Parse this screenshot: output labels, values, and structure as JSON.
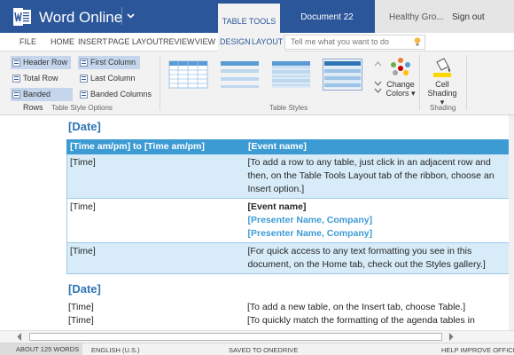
{
  "titlebar": {
    "app_name": "Word Online",
    "context_tab": "TABLE TOOLS",
    "document_title": "Document 22",
    "user_name": "Healthy Gro...",
    "sign_out": "Sign out"
  },
  "ribbon_tabs": [
    {
      "label": "FILE"
    },
    {
      "label": "HOME"
    },
    {
      "label": "INSERT"
    },
    {
      "label": "PAGE LAYOUT"
    },
    {
      "label": "REVIEW"
    },
    {
      "label": "VIEW"
    },
    {
      "label": "DESIGN",
      "contextual": true
    },
    {
      "label": "LAYOUT",
      "contextual": true
    }
  ],
  "tell_me": {
    "placeholder": "Tell me what you want to do",
    "icon": "lightbulb-icon"
  },
  "table_style_options": {
    "group_label": "Table Style Options",
    "checkboxes": [
      {
        "label": "Header Row",
        "checked": true
      },
      {
        "label": "First Column",
        "checked": true
      },
      {
        "label": "Total Row",
        "checked": false
      },
      {
        "label": "Last Column",
        "checked": false
      },
      {
        "label": "Banded Rows",
        "checked": true
      },
      {
        "label": "Banded Columns",
        "checked": false
      }
    ]
  },
  "table_styles": {
    "group_label": "Table Styles",
    "change_colors_line1": "Change",
    "change_colors_line2": "Colors ▾"
  },
  "shading": {
    "group_label": "Shading",
    "button_line1": "Cell",
    "button_line2": "Shading ▾"
  },
  "document": {
    "date_heading_1": "[Date]",
    "table": {
      "header": [
        "[Time am/pm] to [Time am/pm]",
        "[Event name]"
      ],
      "rows": [
        {
          "time": "[Time]",
          "text": "[To add a row to any table, just click in an adjacent row and then, on the Table Tools Layout tab of the ribbon, choose an Insert option.]"
        },
        {
          "time": "[Time]",
          "event": "[Event name]",
          "presenter1": "[Presenter Name, Company]",
          "presenter2": "[Presenter Name, Company]"
        },
        {
          "time": "[Time]",
          "text": "[For quick access to any text formatting you see in this document, on the Home tab, check out the Styles gallery.]"
        }
      ]
    },
    "date_heading_2": "[Date]",
    "plain_rows": [
      {
        "time": "[Time]",
        "text": "[To add a new table, on the Insert tab, choose Table.]"
      },
      {
        "time": "[Time]",
        "text": "[To quickly match the formatting of the agenda tables in"
      }
    ]
  },
  "statusbar": {
    "words": "ABOUT 125 WORDS",
    "language": "ENGLISH (U.S.)",
    "saved": "SAVED TO ONEDRIVE",
    "help": "HELP IMPROVE OFFICE"
  },
  "colors": {
    "brand_blue": "#2b579a",
    "header_blue": "#3d9bd4",
    "band_blue": "#d7ebf8",
    "heading_blue": "#2e74b5"
  }
}
